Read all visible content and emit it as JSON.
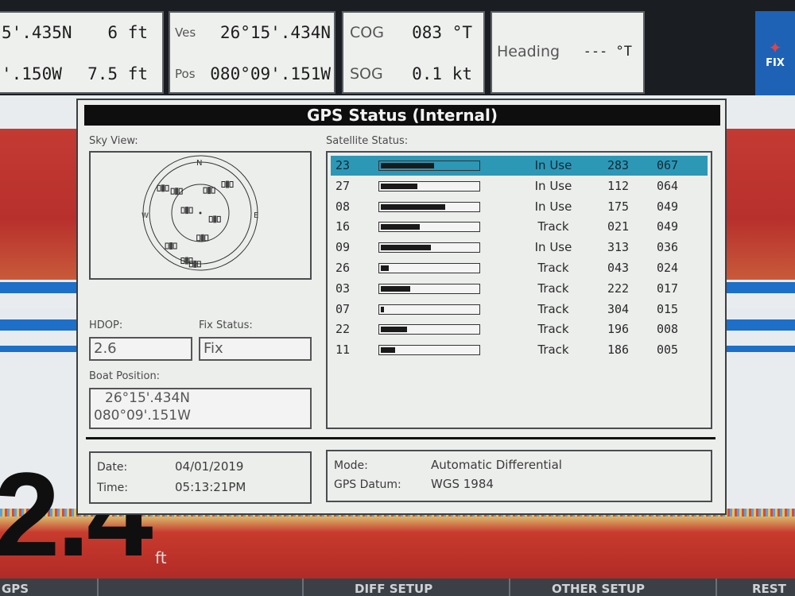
{
  "topbar": {
    "box1": {
      "lat": "5'.435N",
      "val1": "6 ft",
      "lon": "'.150W",
      "val2": "7.5 ft"
    },
    "box2": {
      "label_ves": "Ves",
      "ves": "26°15'.434N",
      "label_pos": "Pos",
      "pos": "080°09'.151W"
    },
    "box3": {
      "label_cog": "COG",
      "cog": "083 °T",
      "label_sog": "SOG",
      "sog": "0.1 kt"
    },
    "box4": {
      "label_heading": "Heading",
      "heading": "--- °T"
    },
    "fix_badge": {
      "label": "FIX"
    }
  },
  "depth": {
    "value": "2.4",
    "unit": "ft"
  },
  "dialog": {
    "title": "GPS Status (Internal)",
    "sky_view_label": "Sky View:",
    "satellite_status_label": "Satellite Status:",
    "sky_compass": {
      "n": "N",
      "e": "E",
      "w": "W"
    },
    "hdop_label": "HDOP:",
    "hdop": "2.6",
    "fix_status_label": "Fix Status:",
    "fix_status": "Fix",
    "boat_position_label": "Boat Position:",
    "boat_lat": "26°15'.434N",
    "boat_lon": "080°09'.151W",
    "date_label": "Date:",
    "date": "04/01/2019",
    "time_label": "Time:",
    "time": "05:13:21PM",
    "mode_label": "Mode:",
    "mode": "Automatic Differential",
    "datum_label": "GPS Datum:",
    "datum": "WGS 1984"
  },
  "satellites": [
    {
      "id": "23",
      "signal": 0.55,
      "status": "In Use",
      "az": "283",
      "el": "067",
      "selected": true
    },
    {
      "id": "27",
      "signal": 0.38,
      "status": "In Use",
      "az": "112",
      "el": "064"
    },
    {
      "id": "08",
      "signal": 0.66,
      "status": "In Use",
      "az": "175",
      "el": "049"
    },
    {
      "id": "16",
      "signal": 0.4,
      "status": "Track",
      "az": "021",
      "el": "049"
    },
    {
      "id": "09",
      "signal": 0.52,
      "status": "In Use",
      "az": "313",
      "el": "036"
    },
    {
      "id": "26",
      "signal": 0.08,
      "status": "Track",
      "az": "043",
      "el": "024"
    },
    {
      "id": "03",
      "signal": 0.3,
      "status": "Track",
      "az": "222",
      "el": "017"
    },
    {
      "id": "07",
      "signal": 0.03,
      "status": "Track",
      "az": "304",
      "el": "015"
    },
    {
      "id": "22",
      "signal": 0.27,
      "status": "Track",
      "az": "196",
      "el": "008"
    },
    {
      "id": "11",
      "signal": 0.15,
      "status": "Track",
      "az": "186",
      "el": "005"
    }
  ],
  "softkeys": {
    "k1": "GPS",
    "k2": "DIFF SETUP",
    "k3": "OTHER SETUP",
    "k4": "REST"
  }
}
